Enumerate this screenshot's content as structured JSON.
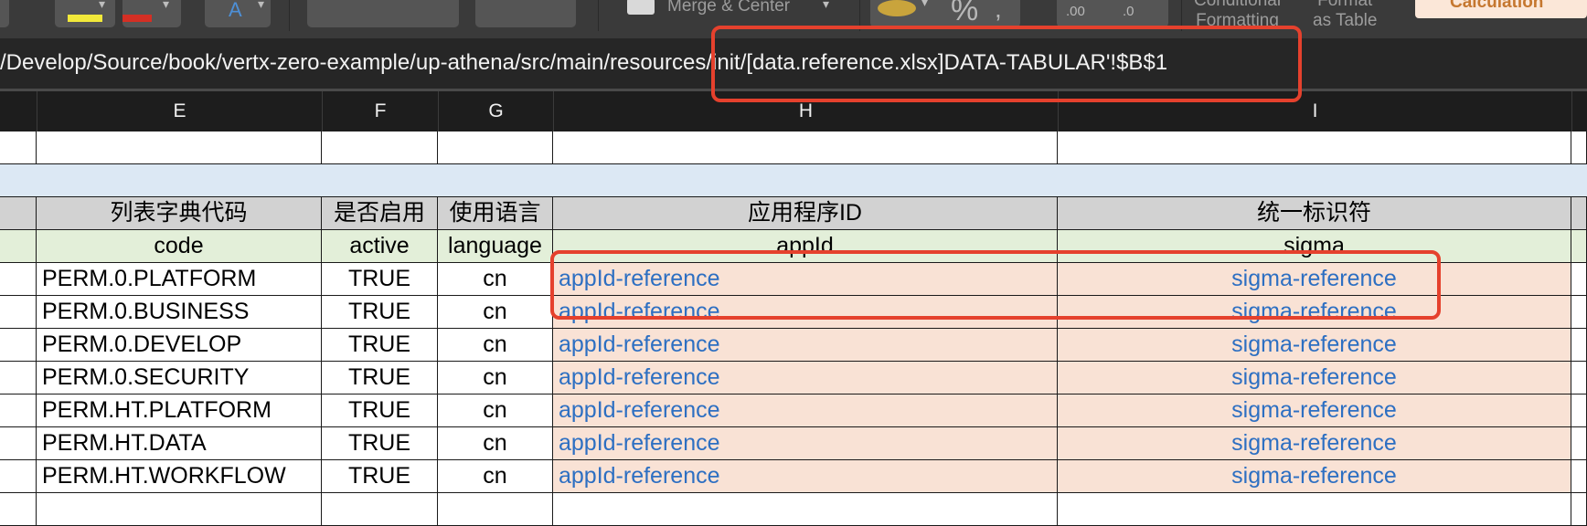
{
  "ribbon": {
    "merge_label": "Merge & Center",
    "percent_label": "%",
    "decimal_increase_label": ".00",
    "decimal_decrease_label": ".0",
    "conditional_formatting_label": "Conditional\nFormatting",
    "format_as_table_label": "Format\nas Table",
    "calculation_label": "Calculation",
    "colors": {
      "highlight": "#f2e93a",
      "font": "#d42f24"
    }
  },
  "formula_bar": {
    "text": "/Develop/Source/book/vertx-zero-example/up-athena/src/main/resources/init/[data.reference.xlsx]DATA-TABULAR'!$B$1"
  },
  "sheet": {
    "column_headers": [
      "E",
      "F",
      "G",
      "H",
      "I"
    ],
    "header_row": [
      "列表字典代码",
      "是否启用",
      "使用语言",
      "应用程序ID",
      "统一标识符"
    ],
    "field_row": [
      "code",
      "active",
      "language",
      "appId",
      "sigma"
    ],
    "rows": [
      [
        "PERM.0.PLATFORM",
        "TRUE",
        "cn",
        "appId-reference",
        "sigma-reference"
      ],
      [
        "PERM.0.BUSINESS",
        "TRUE",
        "cn",
        "appId-reference",
        "sigma-reference"
      ],
      [
        "PERM.0.DEVELOP",
        "TRUE",
        "cn",
        "appId-reference",
        "sigma-reference"
      ],
      [
        "PERM.0.SECURITY",
        "TRUE",
        "cn",
        "appId-reference",
        "sigma-reference"
      ],
      [
        "PERM.HT.PLATFORM",
        "TRUE",
        "cn",
        "appId-reference",
        "sigma-reference"
      ],
      [
        "PERM.HT.DATA",
        "TRUE",
        "cn",
        "appId-reference",
        "sigma-reference"
      ],
      [
        "PERM.HT.WORKFLOW",
        "TRUE",
        "cn",
        "appId-reference",
        "sigma-reference"
      ]
    ]
  },
  "annotation_color": "#e5412d"
}
